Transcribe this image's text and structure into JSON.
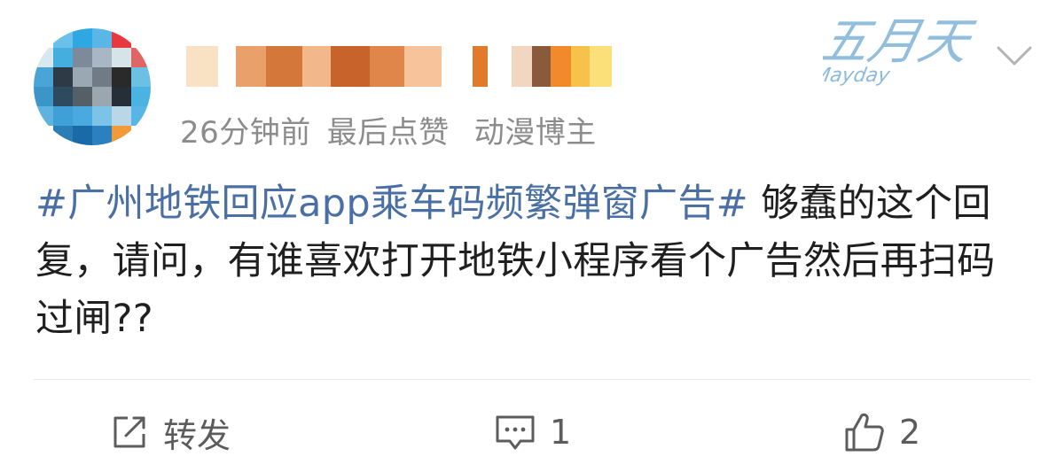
{
  "post": {
    "meta": {
      "time": "26分钟前",
      "activity": "最后点赞",
      "badge": "动漫博主"
    },
    "content": {
      "hashtag": "#广州地铁回应app乘车码频繁弹窗广告#",
      "body": " 够蠢的这个回复，请问，有谁喜欢打开地铁小程序看个广告然后再扫码过闸??"
    },
    "brand_logo": {
      "top": "五月天",
      "bottom": "Mayday"
    },
    "actions": {
      "repost_label": "转发",
      "comment_count": "1",
      "like_count": "2"
    }
  },
  "icons": {
    "avatar": "pixelated-avatar",
    "more": "chevron-down-icon",
    "repost": "repost-icon",
    "comment": "comment-icon",
    "like": "thumbs-up-icon"
  },
  "colors": {
    "hashtag": "#4a6fa5",
    "meta_text": "#8c8c8c",
    "body_text": "#1f1f1f",
    "action_text": "#5c5c5c",
    "logo": "#7fb3d8"
  }
}
